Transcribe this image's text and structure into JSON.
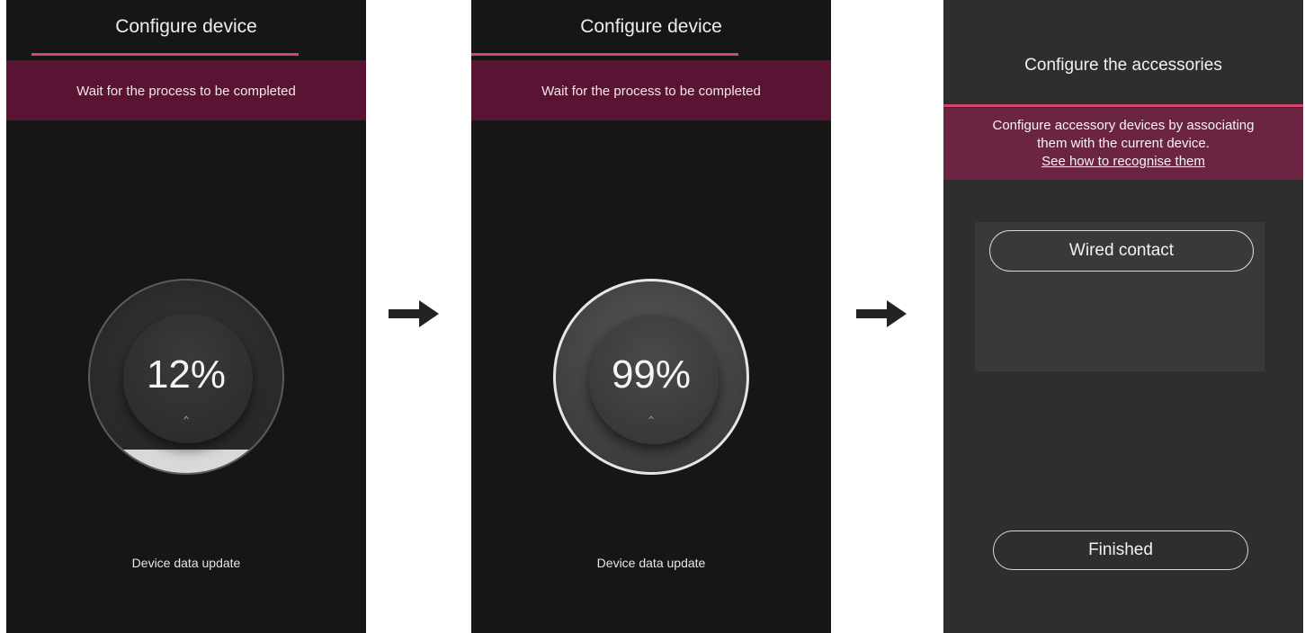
{
  "screens": [
    {
      "title": "Configure device",
      "banner": "Wait for the process to be completed",
      "progress_percent": 12,
      "progress_text": "12%",
      "icon": "connector-icon",
      "status": "Device data update"
    },
    {
      "title": "Configure device",
      "banner": "Wait for the process to be completed",
      "progress_percent": 99,
      "progress_text": "99%",
      "icon": "connector-icon",
      "status": "Device data update"
    },
    {
      "title": "Configure the accessories",
      "banner_line1": "Configure accessory devices by associating",
      "banner_line2": "them with the current device.",
      "banner_link": "See how to recognise them",
      "accessory_button": "Wired contact",
      "finish_button": "Finished"
    }
  ],
  "colors": {
    "accent": "#d0466c",
    "banner": "#5a1433",
    "banner_accessories": "#6b2441",
    "screen_bg": "#161616",
    "screen_bg_accessories": "#2f2d2e"
  },
  "flow_arrows": [
    "arrow-right-icon",
    "arrow-right-icon"
  ]
}
